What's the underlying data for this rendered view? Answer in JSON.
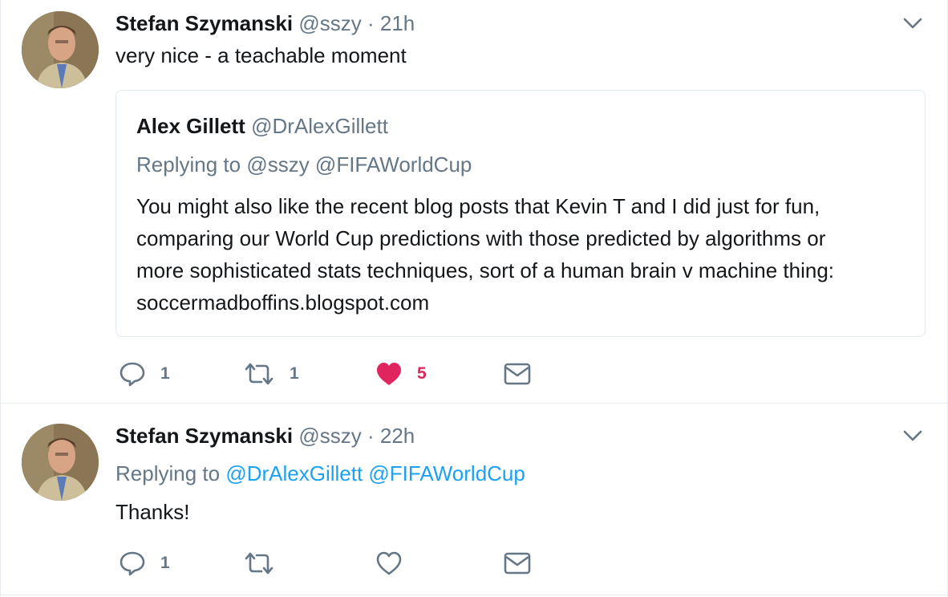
{
  "tweets": [
    {
      "fullname": "Stefan Szymanski",
      "username": "@sszy",
      "dot": "·",
      "time": "21h",
      "text": "very nice - a teachable moment",
      "quoted": {
        "fullname": "Alex Gillett",
        "username": "@DrAlexGillett",
        "replying_prefix": "Replying to",
        "replying_to": "@sszy @FIFAWorldCup",
        "text_lines": [
          "You might also like the recent blog posts that Kevin T and I did just for fun,",
          "comparing our World Cup predictions with those predicted by algorithms or",
          "more sophisticated stats techniques, sort of a human brain v machine thing:",
          "soccermadboffins.blogspot.com"
        ]
      },
      "actions": {
        "reply_count": "1",
        "retweet_count": "1",
        "like_count": "5",
        "liked": true
      }
    },
    {
      "fullname": "Stefan Szymanski",
      "username": "@sszy",
      "dot": "·",
      "time": "22h",
      "replying_prefix": "Replying to",
      "replying_to": "@DrAlexGillett @FIFAWorldCup",
      "text": "Thanks!",
      "actions": {
        "reply_count": "1",
        "retweet_count": "",
        "like_count": "",
        "liked": false
      }
    }
  ],
  "colors": {
    "text": "#14171a",
    "secondary": "#657786",
    "link": "#1da1f2",
    "like": "#e0245e",
    "border": "#e6ecf0"
  },
  "icons": {
    "reply": "reply-icon",
    "retweet": "retweet-icon",
    "like": "heart-icon",
    "dm": "envelope-icon",
    "caret": "chevron-down-icon"
  }
}
